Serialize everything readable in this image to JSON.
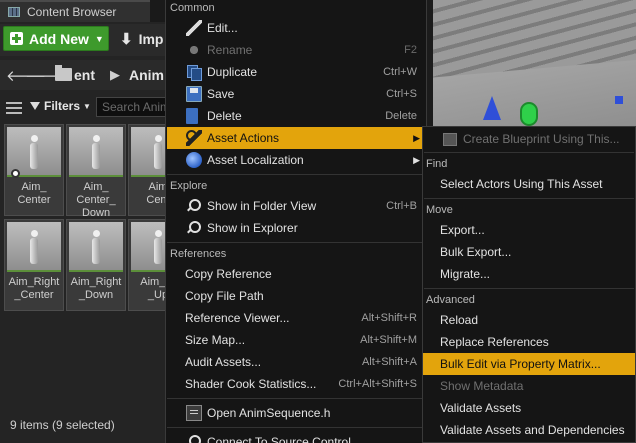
{
  "content_browser": {
    "tab_title": "Content Browser",
    "add_new_label": "Add New",
    "import_label": "Imp",
    "path_crumbs": [
      "ent",
      "Anim"
    ],
    "filters_label": "Filters",
    "search_placeholder": "Search Anim",
    "tiles": [
      {
        "label": "Aim_\nCenter"
      },
      {
        "label": "Aim_\nCenter_\nDown"
      },
      {
        "label": "Aim\nCent"
      },
      {
        "label": "Aim_Right\n_Center"
      },
      {
        "label": "Aim_Right\n_Down"
      },
      {
        "label": "Aim_Ri\n_Up"
      }
    ],
    "status": "9 items (9 selected)"
  },
  "context_menu": {
    "sections": {
      "common": "Common",
      "explore": "Explore",
      "references": "References"
    },
    "items": [
      {
        "label": "Edit...",
        "shortcut": "",
        "icon": "pencil-icon"
      },
      {
        "label": "Rename",
        "shortcut": "F2",
        "icon": "rename-icon"
      },
      {
        "label": "Duplicate",
        "shortcut": "Ctrl+W",
        "icon": "duplicate-icon"
      },
      {
        "label": "Save",
        "shortcut": "Ctrl+S",
        "icon": "save-icon"
      },
      {
        "label": "Delete",
        "shortcut": "Delete",
        "icon": "delete-icon"
      },
      {
        "label": "Asset Actions",
        "shortcut": "",
        "icon": "wrench-icon"
      },
      {
        "label": "Asset Localization",
        "shortcut": "",
        "icon": "globe-icon"
      },
      {
        "label": "Show in Folder View",
        "shortcut": "Ctrl+B",
        "icon": "search-icon"
      },
      {
        "label": "Show in Explorer",
        "shortcut": "",
        "icon": "search-icon"
      },
      {
        "label": "Copy Reference",
        "shortcut": ""
      },
      {
        "label": "Copy File Path",
        "shortcut": ""
      },
      {
        "label": "Reference Viewer...",
        "shortcut": "Alt+Shift+R"
      },
      {
        "label": "Size Map...",
        "shortcut": "Alt+Shift+M"
      },
      {
        "label": "Audit Assets...",
        "shortcut": "Alt+Shift+A"
      },
      {
        "label": "Shader Cook Statistics...",
        "shortcut": "Ctrl+Alt+Shift+S"
      },
      {
        "label": "Open AnimSequence.h",
        "shortcut": "",
        "icon": "code-file-icon"
      },
      {
        "label": "Connect To Source Control...",
        "shortcut": ""
      }
    ]
  },
  "submenu": {
    "sections": {
      "find": "Find",
      "move": "Move",
      "advanced": "Advanced"
    },
    "items": [
      {
        "label": "Create Blueprint Using This...",
        "icon": "blueprint-icon"
      },
      {
        "label": "Select Actors Using This Asset"
      },
      {
        "label": "Export..."
      },
      {
        "label": "Bulk Export..."
      },
      {
        "label": "Migrate..."
      },
      {
        "label": "Reload"
      },
      {
        "label": "Replace References"
      },
      {
        "label": "Bulk Edit via Property Matrix..."
      },
      {
        "label": "Show Metadata"
      },
      {
        "label": "Validate Assets"
      },
      {
        "label": "Validate Assets and Dependencies"
      }
    ]
  },
  "colors": {
    "highlight": "#e3a40c",
    "add_new_green": "#3e9a2c",
    "menu_bg": "#151515"
  }
}
